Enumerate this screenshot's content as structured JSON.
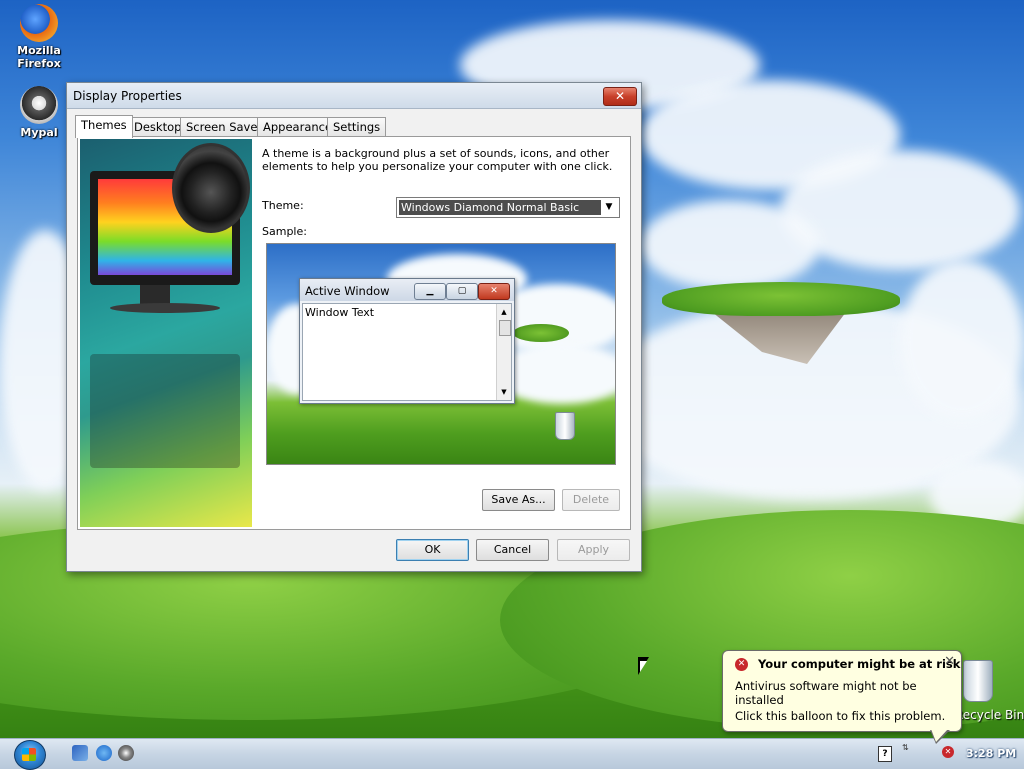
{
  "desktop": {
    "icons": [
      {
        "label_line1": "Mozilla",
        "label_line2": "Firefox",
        "icon": "firefox-icon"
      },
      {
        "label_line1": "Mypal",
        "label_line2": "",
        "icon": "mypal-raccoon-icon"
      }
    ],
    "recycle_bin_label": "Recycle Bin"
  },
  "dialog": {
    "title": "Display Properties",
    "tabs": [
      "Themes",
      "Desktop",
      "Screen Saver",
      "Appearance",
      "Settings"
    ],
    "active_tab": "Themes",
    "description": "A theme is a background plus a set of sounds, icons, and other elements to help you personalize your computer with one click.",
    "theme_label": "Theme:",
    "theme_value": "Windows Diamond Normal Basic",
    "sample_label": "Sample:",
    "sample_window": {
      "title": "Active Window",
      "client_text": "Window Text"
    },
    "buttons": {
      "save_as": "Save As...",
      "delete": "Delete",
      "ok": "OK",
      "cancel": "Cancel",
      "apply": "Apply"
    }
  },
  "balloon": {
    "title": "Your computer might be at risk",
    "line1": "Antivirus software might not be installed",
    "line2": "Click this balloon to fix this problem."
  },
  "taskbar": {
    "clock": "3:28 PM",
    "quick_launch": [
      "show-desktop-icon",
      "internet-explorer-icon",
      "mypal-icon"
    ]
  }
}
